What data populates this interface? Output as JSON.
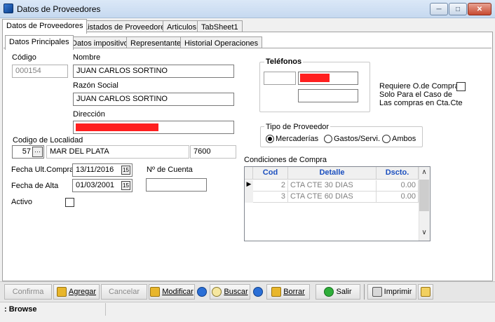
{
  "window": {
    "title": "Datos de Proveedores",
    "min_label": "─",
    "max_label": "□",
    "close_label": "✕"
  },
  "tabs": [
    "Datos de Proveedores",
    "Listados de Proveedores",
    "Articulos",
    "TabSheet1"
  ],
  "subtabs": [
    "Datos Principales",
    "Datos impositivos",
    "Representante",
    "Historial Operaciones"
  ],
  "form": {
    "codigo_label": "Código",
    "codigo_value": "000154",
    "nombre_label": "Nombre",
    "nombre_value": "JUAN CARLOS SORTINO",
    "razon_label": "Razón Social",
    "razon_value": "JUAN CARLOS SORTINO",
    "direccion_label": "Dirección",
    "localidad_label": "Codigo de Localidad",
    "localidad_code": "57",
    "localidad_lookup": "···",
    "localidad_name": "MAR DEL PLATA",
    "localidad_cp": "7600",
    "fecha_ult_label": "Fecha Ult.Compra",
    "fecha_ult_value": "13/11/2016",
    "cuenta_label": "Nº de Cuenta",
    "cuenta_value": "",
    "fecha_alta_label": "Fecha de Alta",
    "fecha_alta_value": "01/03/2001",
    "activo_label": "Activo",
    "date_icon": "15"
  },
  "telefonos": {
    "title": "Teléfonos"
  },
  "requiere": {
    "line1": "Requiere O.de Compra",
    "line2": "Solo Para el Caso de",
    "line3": "Las compras en Cta.Cte"
  },
  "tipo": {
    "title": "Tipo de Proveedor",
    "options": [
      "Mercaderías",
      "Gastos/Servi.",
      "Ambos"
    ],
    "selected": "Mercaderías"
  },
  "condiciones": {
    "title": "Condiciones de Compra",
    "headers": [
      "Cod",
      "Detalle",
      "Dscto."
    ],
    "rows": [
      {
        "cod": "2",
        "detalle": "CTA CTE 30 DIAS",
        "dscto": "0.00"
      },
      {
        "cod": "3",
        "detalle": "CTA CTE 60 DIAS",
        "dscto": "0.00"
      }
    ],
    "row_marker": "▶",
    "scroll_up": "∧",
    "scroll_down": "∨"
  },
  "toolbar": {
    "confirma": "Confirma",
    "agregar": "Agregar",
    "cancelar": "Cancelar",
    "modificar": "Modificar",
    "buscar": "Buscar",
    "borrar": "Borrar",
    "salir": "Salir",
    "imprimir": "Imprimir"
  },
  "status": {
    "text": ": Browse"
  },
  "colors": {
    "accent": "#1b4fbf",
    "redaction": "#ff1f1f"
  }
}
